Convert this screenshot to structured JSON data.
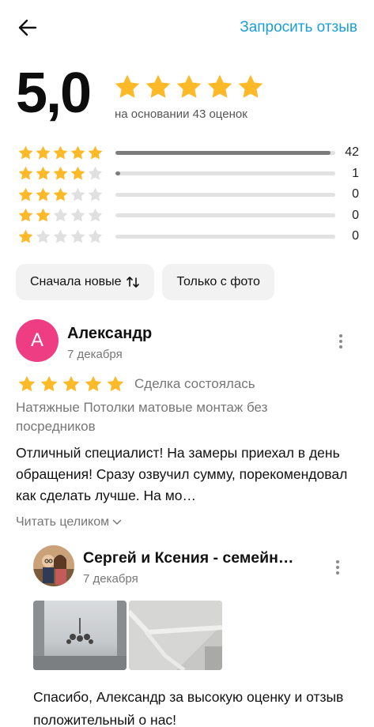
{
  "header": {
    "back_icon": "arrow-left-icon",
    "request_label": "Запросить отзыв"
  },
  "summary": {
    "score": "5,0",
    "stars_shown": 5,
    "based_on": "на основании 43 оценок"
  },
  "distribution": [
    {
      "stars": 5,
      "count": "42",
      "fraction": 0.977
    },
    {
      "stars": 4,
      "count": "1",
      "fraction": 0.023
    },
    {
      "stars": 3,
      "count": "0",
      "fraction": 0
    },
    {
      "stars": 2,
      "count": "0",
      "fraction": 0
    },
    {
      "stars": 1,
      "count": "0",
      "fraction": 0
    }
  ],
  "filters": {
    "sort_label": "Сначала новые",
    "photo_label": "Только с фото"
  },
  "review": {
    "avatar_letter": "А",
    "author": "Александр",
    "date": "7 декабря",
    "rating": 5,
    "deal_status": "Сделка состоялась",
    "subject": "Натяжные Потолки матовые монтаж без посредников",
    "text": "Отличный специалист! На замеры приехал в день обращения! Сразу озвучил сумму, порекомендовал как сделать лучше. На мо…",
    "read_more": "Читать целиком"
  },
  "reply": {
    "author": "Сергей и Ксения - семейн…",
    "date": "7 декабря",
    "text": "Спасибо, Александр за высокую оценку и отзыв положительный о нас!"
  },
  "colors": {
    "accent": "#1a9fd8",
    "star": "#fdb927",
    "star_empty": "#e0e0e0",
    "avatar": "#ee3d82"
  }
}
